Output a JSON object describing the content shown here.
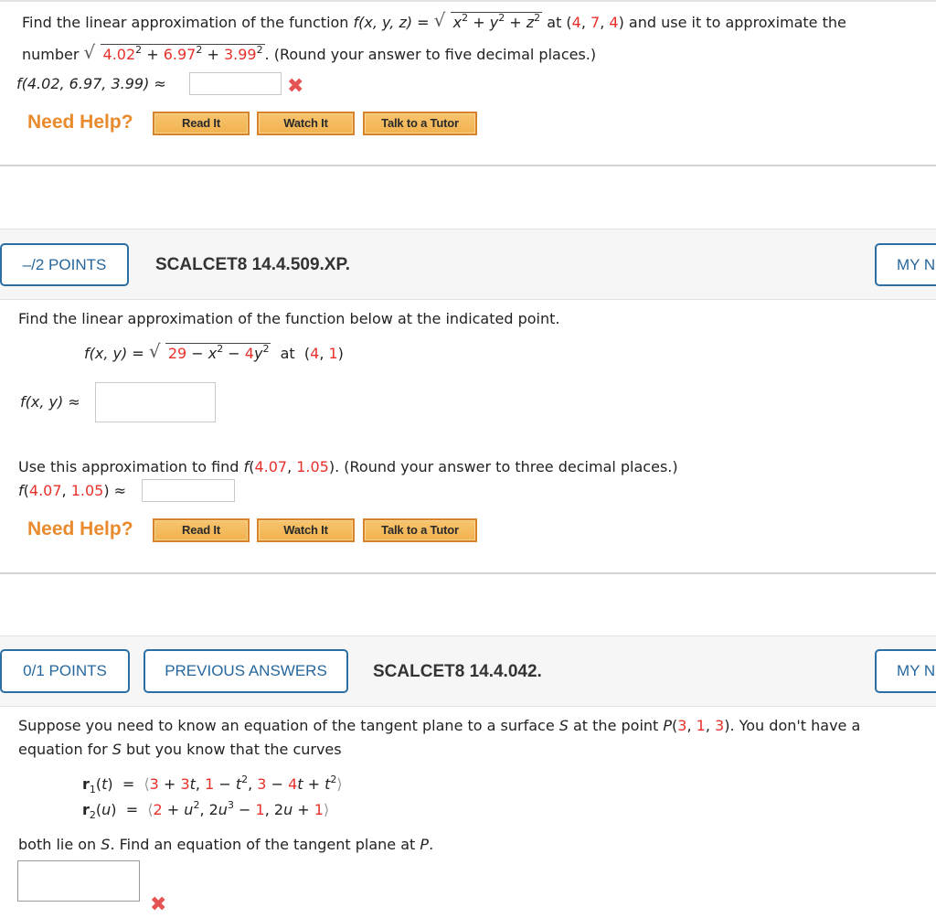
{
  "q1": {
    "intro_a": "Find the linear approximation of the function ",
    "func_lhs": "f(x, y, z) = ",
    "radicand": {
      "x": "x",
      "y": "y",
      "z": "z",
      "exp": "2",
      "plus": " + "
    },
    "intro_b": " at (",
    "point": [
      "4",
      "7",
      "4"
    ],
    "intro_c": ") and use it to approximate the",
    "number_label": "number ",
    "num_values": [
      "4.02",
      "6.97",
      "3.99"
    ],
    "round_note": ". (Round your answer to five decimal places.)",
    "answer_label": "f(4.02, 6.97, 3.99) ≈",
    "answer_value": "",
    "answer_status": "incorrect",
    "help": {
      "label": "Need Help?",
      "read": "Read It",
      "watch": "Watch It",
      "tutor": "Talk to a Tutor"
    }
  },
  "q2": {
    "points": "–/2 POINTS",
    "id": "SCALCET8 14.4.509.XP.",
    "my_notes": "MY N",
    "prompt": "Find the linear approximation of the function below at the indicated point.",
    "func_lhs": "f(x, y) = ",
    "radicand": {
      "c": "29",
      "minus1": " − ",
      "x2": "x",
      "minus2": " − ",
      "coef": "4",
      "y2": "y",
      "exp": "2"
    },
    "at": "at",
    "point": [
      "4",
      "1"
    ],
    "approx_label": "f(x, y) ≈",
    "approx_value": "",
    "use_prompt_a": "Use this approximation to find ",
    "use_point": [
      "4.07",
      "1.05"
    ],
    "use_prompt_b": ". (Round your answer to three decimal places.)",
    "answer_label_prefix": "f(",
    "answer_label_suffix": ") ≈",
    "answer_value": "",
    "help": {
      "label": "Need Help?",
      "read": "Read It",
      "watch": "Watch It",
      "tutor": "Talk to a Tutor"
    }
  },
  "q3": {
    "points": "0/1 POINTS",
    "previous_answers": "PREVIOUS ANSWERS",
    "id": "SCALCET8 14.4.042.",
    "my_notes": "MY N",
    "prompt_a": "Suppose you need to know an equation of the tangent plane to a surface ",
    "S": "S",
    "prompt_b": " at the point  ",
    "P": "P",
    "point": [
      "3",
      "1",
      "3"
    ],
    "prompt_c": ").  You don't have a",
    "prompt_line2_a": "equation for ",
    "prompt_line2_b": " but you know that the curves",
    "r1_label": "r",
    "r1_sub": "1",
    "r1_var": "t",
    "r2_label": "r",
    "r2_sub": "2",
    "r2_var": "u",
    "final_a": "both lie on ",
    "final_b": ". Find an equation of the tangent plane at ",
    "final_c": ".",
    "answer_value": "",
    "answer_status": "incorrect"
  },
  "colors": {
    "accent_blue": "#2a6ea3",
    "highlight_red": "#e8302a",
    "help_orange": "#e98a2c"
  }
}
